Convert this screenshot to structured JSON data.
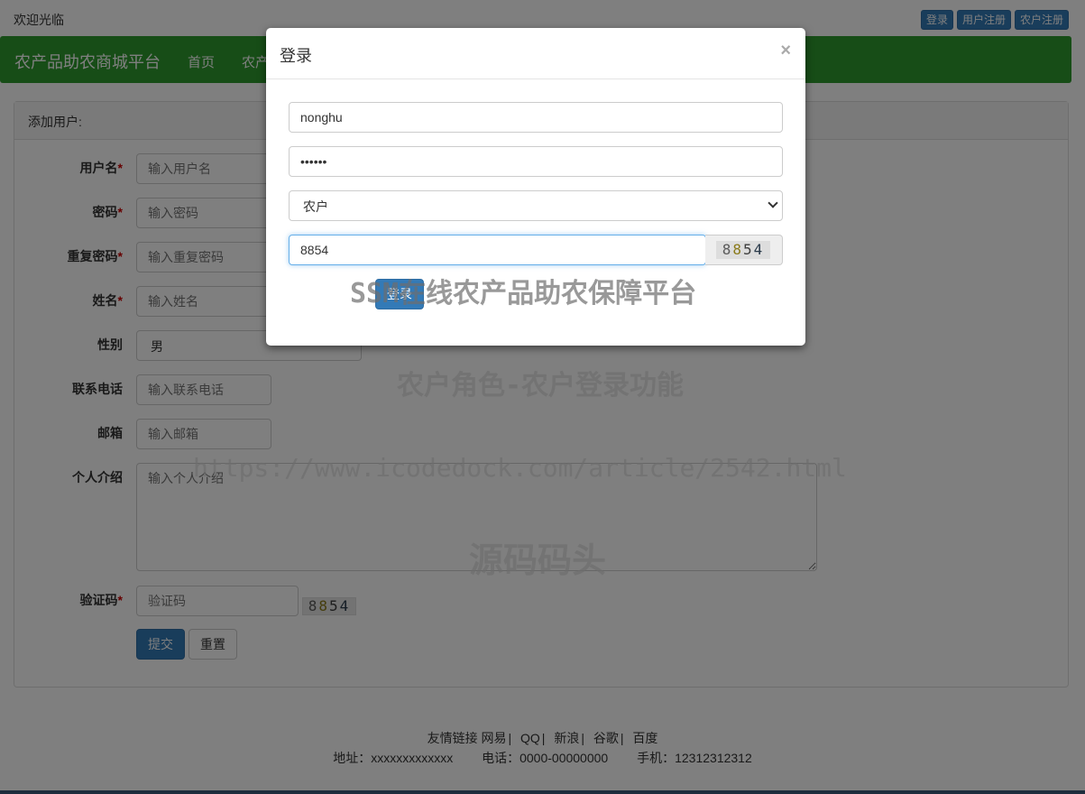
{
  "topbar": {
    "welcome": "欢迎光临",
    "buttons": [
      "登录",
      "用户注册",
      "农户注册"
    ]
  },
  "navbar": {
    "brand": "农产品助农商城平台",
    "items": [
      "首页",
      "农产"
    ]
  },
  "panel": {
    "title": "添加用户:",
    "fields": {
      "username": {
        "label": "用户名",
        "placeholder": "输入用户名"
      },
      "password": {
        "label": "密码",
        "placeholder": "输入密码"
      },
      "repeat_password": {
        "label": "重复密码",
        "placeholder": "输入重复密码"
      },
      "name": {
        "label": "姓名",
        "placeholder": "输入姓名"
      },
      "gender": {
        "label": "性别",
        "value": "男"
      },
      "phone": {
        "label": "联系电话",
        "placeholder": "输入联系电话"
      },
      "email": {
        "label": "邮箱",
        "placeholder": "输入邮箱"
      },
      "intro": {
        "label": "个人介绍",
        "placeholder": "输入个人介绍"
      },
      "captcha": {
        "label": "验证码",
        "placeholder": "验证码"
      }
    },
    "required_mark": "*",
    "captcha_chars": [
      "8",
      "8",
      "5",
      "4"
    ],
    "submit_label": "提交",
    "reset_label": "重置"
  },
  "footer": {
    "links_label": "友情链接",
    "links": [
      "网易",
      "QQ",
      "新浪",
      "谷歌",
      "百度"
    ],
    "separator": "|",
    "address": "地址：xxxxxxxxxxxxx",
    "phone": "电话：0000-00000000",
    "mobile": "手机：12312312312"
  },
  "modal": {
    "title": "登录",
    "close": "×",
    "username_value": "nonghu",
    "password_value": "••••••",
    "role_value": "农户",
    "captcha_value": "8854",
    "captcha_chars": [
      "8",
      "8",
      "5",
      "4"
    ],
    "login_label": "登录"
  },
  "watermarks": {
    "w1": "SSM在线农产品助农保障平台",
    "w2": "农户角色-农户登录功能",
    "w3": "https://www.icodedock.com/article/2542.html",
    "w4": "源码码头"
  },
  "colors": {
    "navbar": "#2e9b2e",
    "primary": "#337ab7",
    "required": "#cc0000"
  }
}
